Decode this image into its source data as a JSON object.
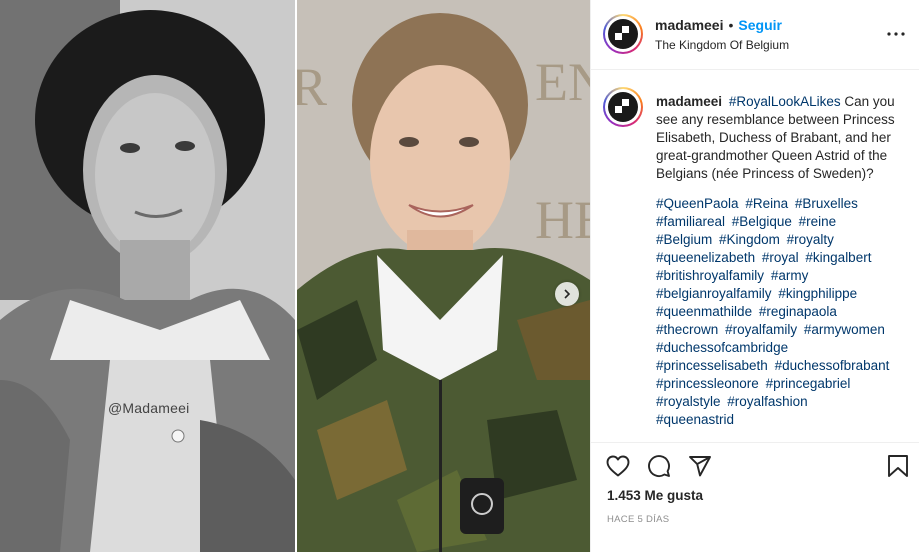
{
  "photo": {
    "watermark": "@Madameei"
  },
  "header": {
    "username": "madameei",
    "separator": "•",
    "follow_label": "Seguir",
    "location": "The Kingdom Of Belgium"
  },
  "caption": {
    "username": "madameei",
    "lead_tag": "#RoyalLookALikes",
    "body": "Can you see any resemblance between Princess Elisabeth, Duchess of Brabant, and her great-grandmother Queen Astrid of the Belgians (née Princess of Sweden)?",
    "hashtags": [
      "#QueenPaola",
      "#Reina",
      "#Bruxelles",
      "#familiareal",
      "#Belgique",
      "#reine",
      "#Belgium",
      "#Kingdom",
      "#royalty",
      "#queenelizabeth",
      "#royal",
      "#kingalbert",
      "#britishroyalfamily",
      "#army",
      "#belgianroyalfamily",
      "#kingphilippe",
      "#queenmathilde",
      "#reginapaola",
      "#thecrown",
      "#royalfamily",
      "#armywomen",
      "#duchessofcambridge",
      "#princesselisabeth",
      "#duchessofbrabant",
      "#princessleonore",
      "#princegabriel",
      "#royalstyle",
      "#royalfashion",
      "#queenastrid"
    ]
  },
  "footer": {
    "likes": "1.453 Me gusta",
    "timestamp": "HACE 5 DÍAS"
  },
  "icons": {
    "like": "heart-icon",
    "comment": "comment-icon",
    "share": "share-icon",
    "save": "bookmark-icon",
    "more": "more-horizontal-icon",
    "next": "chevron-right-icon"
  }
}
